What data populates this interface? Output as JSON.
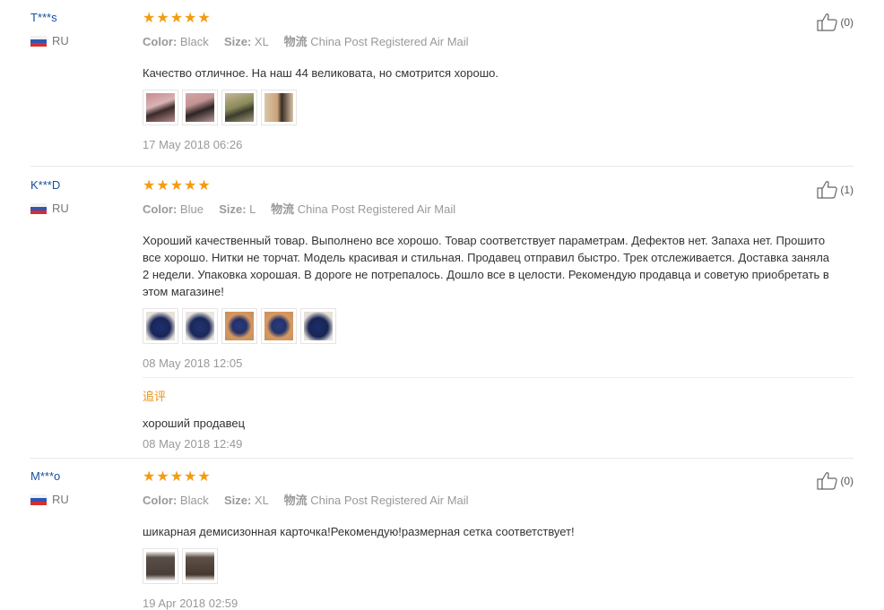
{
  "reviews": [
    {
      "user": "T***s",
      "country": "RU",
      "stars": "★★★★★",
      "color_label": "Color:",
      "color": "Black",
      "size_label": "Size:",
      "size": "XL",
      "shipping_label": "物流",
      "shipping": "China Post Registered Air Mail",
      "text": "Качество отличное. На наш 44 великовата, но смотрится хорошо.",
      "photo_count": 4,
      "date": "17 May 2018 06:26",
      "likes": "(0)"
    },
    {
      "user": "K***D",
      "country": "RU",
      "stars": "★★★★★",
      "color_label": "Color:",
      "color": "Blue",
      "size_label": "Size:",
      "size": "L",
      "shipping_label": "物流",
      "shipping": "China Post Registered Air Mail",
      "text": "Хороший качественный товар. Выполнено все хорошо. Товар соответствует параметрам. Дефектов нет. Запаха нет. Прошито все хорошо. Нитки не торчат. Модель красивая и стильная. Продавец отправил быстро. Трек отслеживается. Доставка заняла 2 недели. Упаковка хорошая. В дороге не потрепалось. Дошло все в целости. Рекомендую продавца и советую приобретать в этом магазине!",
      "photo_count": 5,
      "date": "08 May 2018 12:05",
      "likes": "(1)",
      "additional": {
        "title": "追评",
        "text": "хороший продавец",
        "date": "08 May 2018 12:49"
      }
    },
    {
      "user": "M***o",
      "country": "RU",
      "stars": "★★★★★",
      "color_label": "Color:",
      "color": "Black",
      "size_label": "Size:",
      "size": "XL",
      "shipping_label": "物流",
      "shipping": "China Post Registered Air Mail",
      "text": "шикарная демисизонная карточка!Рекомендую!размерная сетка соответствует!",
      "photo_count": 2,
      "date": "19 Apr 2018 02:59",
      "likes": "(0)"
    }
  ],
  "colors": {
    "star": "#f39c12",
    "username": "#1a4fa0",
    "additional_title": "#e8911a",
    "muted": "#999999"
  }
}
